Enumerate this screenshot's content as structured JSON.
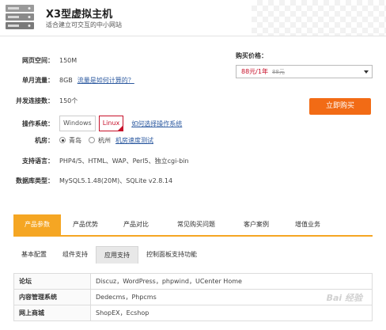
{
  "header": {
    "title": "X3型虚拟主机",
    "subtitle": "适合建立可交互的中小网站"
  },
  "specs": {
    "web_space": {
      "label": "网页空间：",
      "value": "150M"
    },
    "traffic": {
      "label": "单月流量：",
      "value": "8GB",
      "link": "流量是如何计算的？"
    },
    "connections": {
      "label": "并发连接数：",
      "value": "150个"
    },
    "os": {
      "label": "操作系统：",
      "options": [
        "Windows",
        "Linux"
      ],
      "selected": "Linux",
      "link": "如何选择操作系统"
    },
    "datacenter": {
      "label": "机房：",
      "options": [
        "青岛",
        "杭州"
      ],
      "selected": "青岛",
      "link": "机房速度测试"
    },
    "languages": {
      "label": "支持语言：",
      "value": "PHP4/5、HTML、WAP、Perl5、独立cgi-bin"
    },
    "database": {
      "label": "数据库类型：",
      "value": "MySQL5.1.48(20M)、SQLite v2.8.14"
    }
  },
  "purchase": {
    "label": "购买价格：",
    "price": "88元/1年",
    "old_price": "88元",
    "buy_button": "立即购买"
  },
  "tabs": [
    "产品参数",
    "产品优势",
    "产品对比",
    "常见购买问题",
    "客户案例",
    "增值业务"
  ],
  "active_tab": "产品参数",
  "subtabs": [
    "基本配置",
    "组件支持",
    "应用支持",
    "控制面板支持功能"
  ],
  "active_subtab": "应用支持",
  "table": [
    {
      "key": "论坛",
      "value": "Discuz，WordPress，phpwind，UCenter Home"
    },
    {
      "key": "内容管理系统",
      "value": "Dedecms，Phpcms"
    },
    {
      "key": "网上商城",
      "value": "ShopEX，Ecshop"
    }
  ],
  "watermark": "Bai 经验",
  "colors": {
    "accent": "#f5a623",
    "buy": "#f26b15",
    "price": "#c7112a",
    "link": "#2d5aa0"
  }
}
